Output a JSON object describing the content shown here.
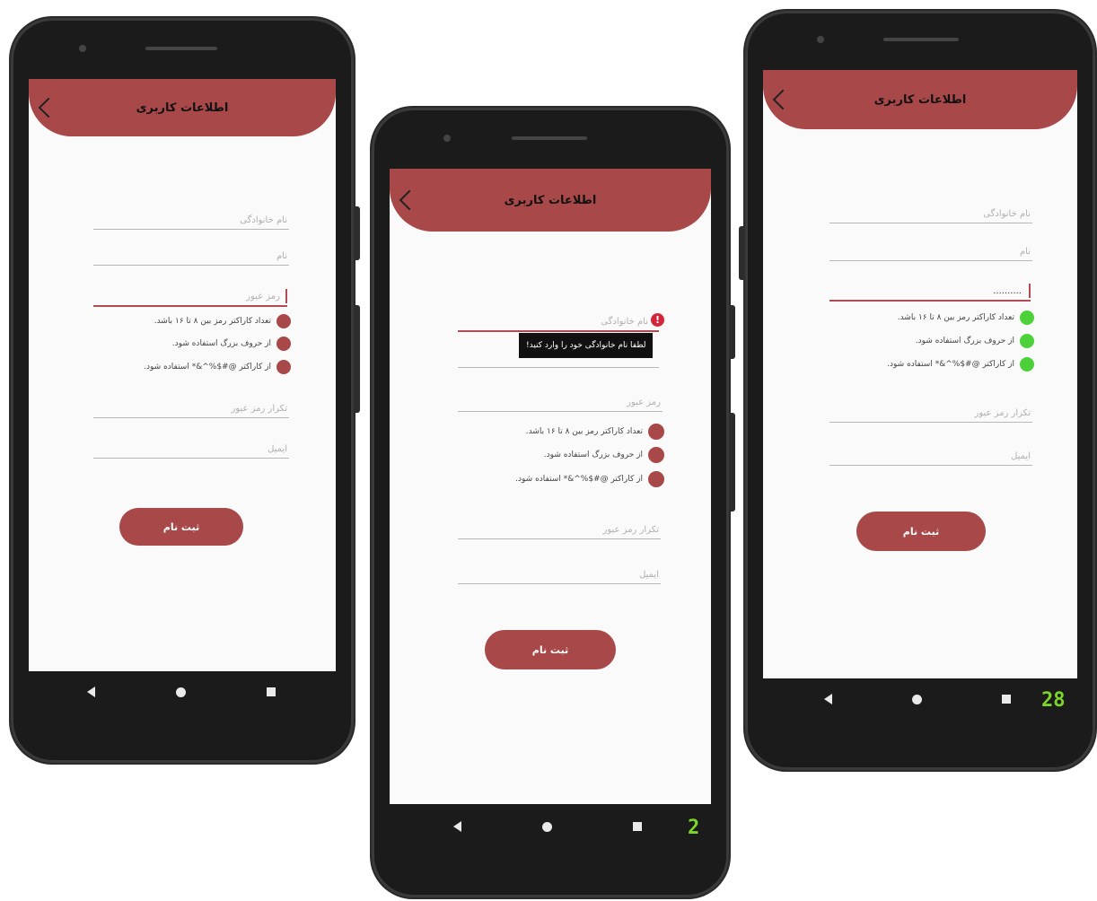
{
  "common": {
    "header_title": "اطلاعات کاربری",
    "submit_label": "ثبت نام",
    "placeholders": {
      "last_name": "نام خانوادگی",
      "first_name": "نام",
      "password": "رمز عبور",
      "confirm_password": "تکرار رمز عبور",
      "email": "ایمیل"
    },
    "rules": [
      "تعداد کاراکتر رمز بین ۸ تا ۱۶ باشد.",
      "از حروف بزرگ استفاده شود.",
      "از کاراکتر @#$%^&* استفاده شود."
    ]
  },
  "phone2": {
    "tooltip": "لطفا نام خانوادگی خود را وارد کنید!",
    "error_mark": "!",
    "screen_number": "2"
  },
  "phone3": {
    "password_value": "..........",
    "screen_number": "28"
  },
  "colors": {
    "accent": "#a84848",
    "rule_pending": "#a84848",
    "rule_ok": "#4cd13a",
    "error": "#d4263a"
  }
}
